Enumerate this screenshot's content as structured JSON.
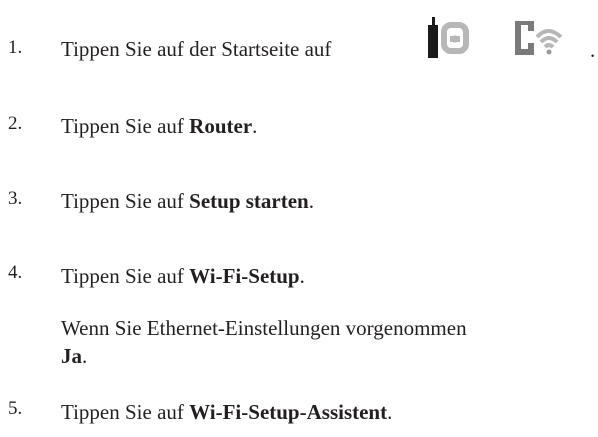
{
  "steps": [
    {
      "number": "1.",
      "prefix": "Tippen Sie auf der Startseite auf",
      "suffix": "."
    },
    {
      "number": "2.",
      "prefix": "Tippen Sie auf ",
      "bold": "Router",
      "suffix": "."
    },
    {
      "number": "3.",
      "prefix": "Tippen Sie auf ",
      "bold": "Setup starten",
      "suffix": "."
    },
    {
      "number": "4.",
      "prefix": "Tippen Sie auf ",
      "bold": "Wi-Fi-Setup",
      "suffix": ".",
      "note_line1": "Wenn Sie Ethernet-Einstellungen vorgenommen",
      "note_bold": "Ja",
      "note_suffix": "."
    },
    {
      "number": "5.",
      "prefix": "Tippen Sie auf ",
      "bold": "Wi-Fi-Setup-Assistent",
      "suffix": "."
    }
  ],
  "icons": {
    "first": "router-status-icon",
    "second": "wifi-network-icon",
    "color_dark": "#1a1a1a",
    "color_light": "#b7b7b7"
  }
}
